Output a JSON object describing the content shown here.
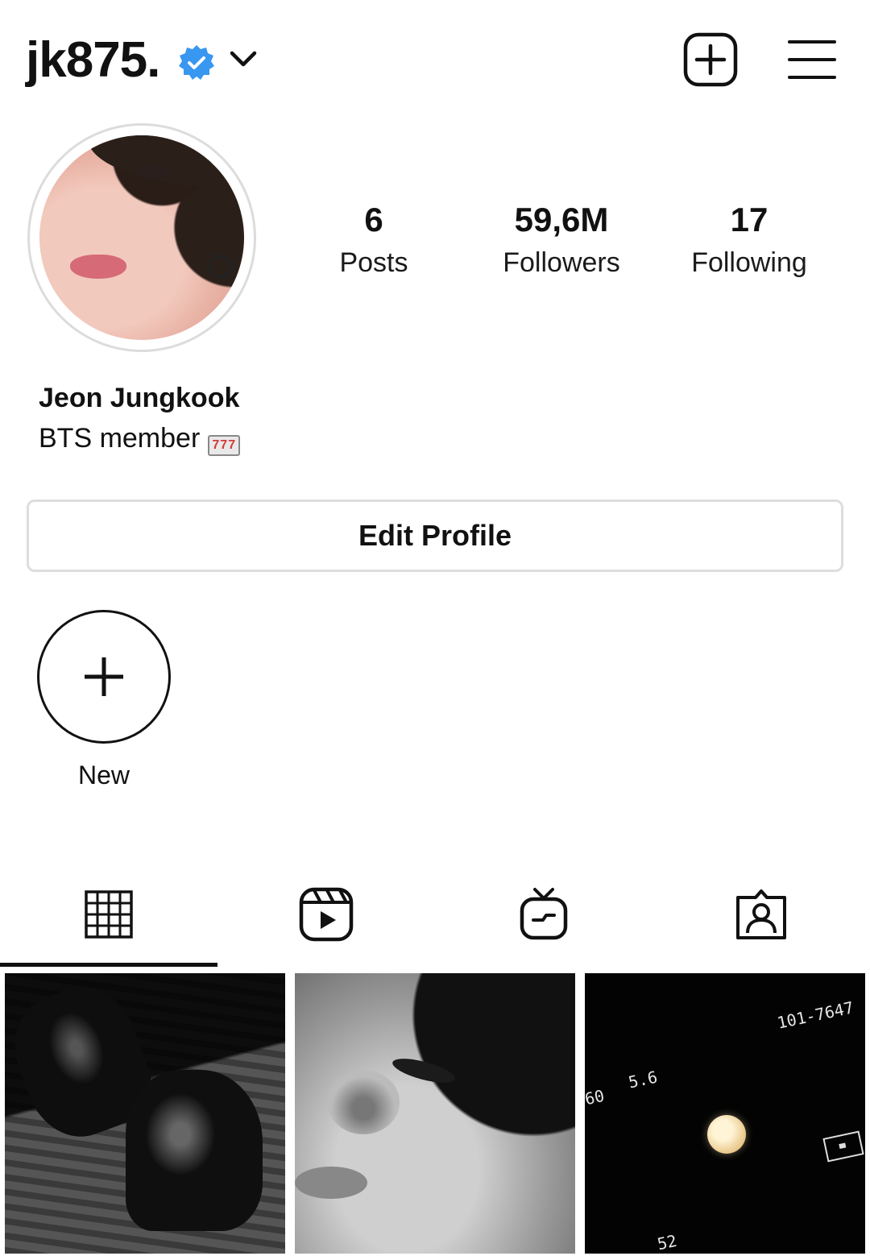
{
  "header": {
    "username": "jk875.",
    "verified": true,
    "icons": {
      "verified": "verified-badge-icon",
      "account_switch": "chevron-down-icon",
      "new_post": "plus-square-icon",
      "menu": "hamburger-menu-icon"
    }
  },
  "profile": {
    "stats": {
      "posts": {
        "value": "6",
        "label": "Posts"
      },
      "followers": {
        "value": "59,6M",
        "label": "Followers"
      },
      "following": {
        "value": "17",
        "label": "Following"
      }
    },
    "name": "Jeon Jungkook",
    "bio": "BTS member",
    "bio_emoji": "777",
    "edit_profile_label": "Edit Profile"
  },
  "highlights": [
    {
      "label": "New",
      "icon": "plus-icon"
    }
  ],
  "tabs": [
    {
      "id": "posts",
      "icon": "grid-icon",
      "active": true
    },
    {
      "id": "reels",
      "icon": "reels-icon",
      "active": false
    },
    {
      "id": "igtv",
      "icon": "igtv-icon",
      "active": false
    },
    {
      "id": "tagged",
      "icon": "tagged-person-icon",
      "active": false
    }
  ],
  "posts": [
    {
      "description_icon": "photo-thumbnail"
    },
    {
      "description_icon": "photo-thumbnail"
    },
    {
      "description_icon": "photo-thumbnail",
      "overlay_text": [
        "101-7647",
        "5.6",
        "60",
        "52"
      ]
    }
  ],
  "colors": {
    "verified": "#3897f0",
    "text": "#111111",
    "border": "#dddddd"
  }
}
